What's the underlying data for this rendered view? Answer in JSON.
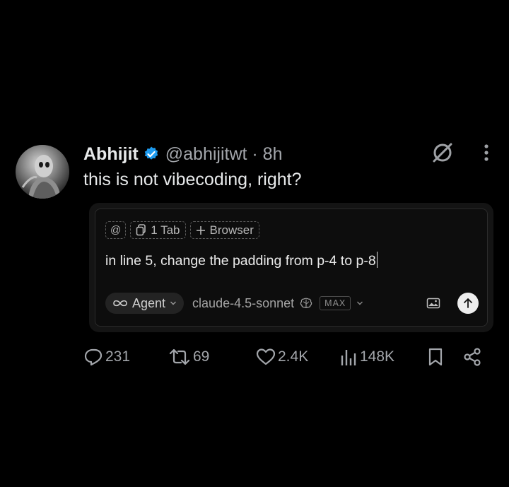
{
  "tweet": {
    "author_name": "Abhijit",
    "handle_time": "@abhijitwt · 8h",
    "text": "this is not vibecoding, right?"
  },
  "composer": {
    "at_chip": "@",
    "tab_chip": "1 Tab",
    "browser_chip": "Browser",
    "prompt_text": "in line 5, change the padding from p-4 to p-8",
    "agent_label": "Agent",
    "model_label": "claude-4.5-sonnet",
    "max_label": "MAX"
  },
  "actions": {
    "replies": "231",
    "retweets": "69",
    "likes": "2.4K",
    "views": "148K"
  },
  "colors": {
    "background": "#000000",
    "verified": "#1d9bf0",
    "text_primary": "#e7e9ea",
    "text_secondary": "#a3a6ab"
  },
  "icons": [
    "verified-badge-icon",
    "grok-slash-icon",
    "more-options-icon",
    "copy-icon",
    "plus-icon",
    "infinity-icon",
    "chevron-down-icon",
    "brain-icon",
    "image-icon",
    "arrow-up-icon",
    "reply-icon",
    "retweet-icon",
    "like-icon",
    "views-icon",
    "bookmark-icon",
    "share-icon"
  ]
}
